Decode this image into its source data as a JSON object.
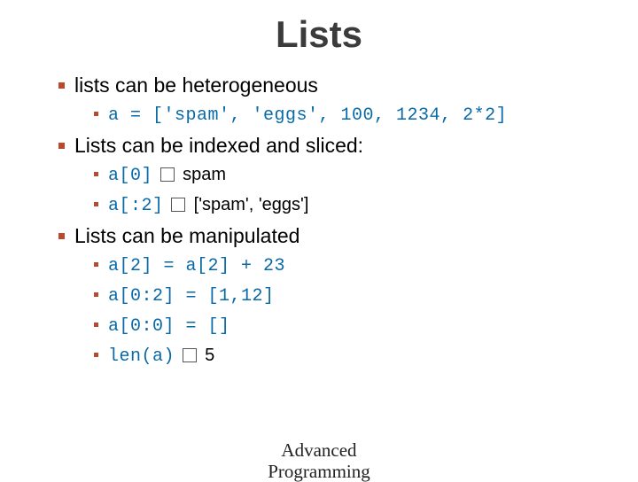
{
  "title": "Lists",
  "bullets": {
    "b1": "lists can be heterogeneous",
    "b1a": "a = ['spam', 'eggs', 100, 1234, 2*2]",
    "b2": "Lists can be indexed and sliced:",
    "b2a_code": "a[0]",
    "b2a_out": " spam",
    "b2b_code": "a[:2]",
    "b2b_out": " ['spam', 'eggs']",
    "b3": "Lists can be manipulated",
    "b3a": "a[2] = a[2] + 23",
    "b3b": "a[0:2] = [1,12]",
    "b3c": "a[0:0] = []",
    "b3d_code": "len(a)",
    "b3d_out": " 5"
  },
  "footer": {
    "line1": "Advanced",
    "line2": "Programming"
  }
}
